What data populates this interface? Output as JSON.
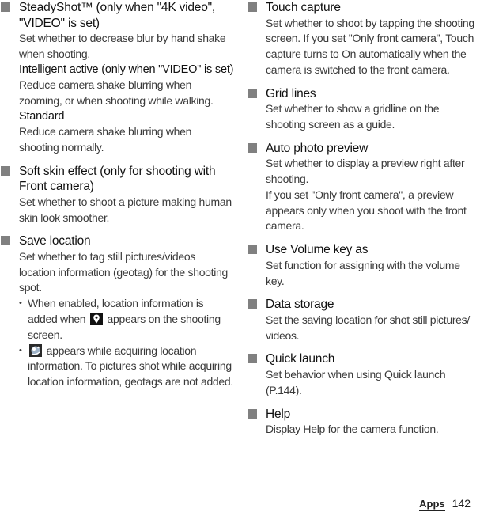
{
  "left_column": {
    "items": [
      {
        "title": "SteadyShot™ (only when \"4K video\", \"VIDEO\" is set)",
        "desc": "Set whether to decrease blur by hand shake when shooting.",
        "options": [
          {
            "label": "Intelligent active (only when \"VIDEO\" is set)",
            "desc": "Reduce camera shake blurring when zooming, or when shooting while walking."
          },
          {
            "label": "Standard",
            "desc": "Reduce camera shake blurring when shooting normally."
          }
        ]
      },
      {
        "title": "Soft skin effect (only for shooting with Front camera)",
        "desc": "Set whether to shoot a picture making human skin look smoother."
      },
      {
        "title": "Save location",
        "desc": "Set whether to tag still pictures/videos location information (geotag) for the shooting spot.",
        "bullets": [
          {
            "before": "When enabled, location information is added when",
            "icon": "location-pin-icon",
            "after": "appears on the shooting screen."
          },
          {
            "before": "",
            "icon": "acquiring-location-icon",
            "after": "appears while acquiring location information. To pictures shot while acquiring location information, geotags are not added."
          }
        ]
      }
    ]
  },
  "right_column": {
    "items": [
      {
        "title": "Touch capture",
        "desc": "Set whether to shoot by tapping the shooting screen. If you set \"Only front camera\", Touch capture turns to On automatically when the camera is switched to the front camera."
      },
      {
        "title": "Grid lines",
        "desc": "Set whether to show a gridline on the shooting screen as a guide."
      },
      {
        "title": "Auto photo preview",
        "desc": "Set whether to display a preview right after shooting.",
        "desc2": "If you set \"Only front camera\", a preview appears only when you shoot with the front camera."
      },
      {
        "title": "Use Volume key as",
        "desc": "Set function for assigning with the volume key."
      },
      {
        "title": "Data storage",
        "desc": "Set the saving location for shot still pictures/ videos."
      },
      {
        "title": "Quick launch",
        "desc": "Set behavior when using Quick launch (P.144)."
      },
      {
        "title": "Help",
        "desc": "Display Help for the camera function."
      }
    ]
  },
  "footer": {
    "section": "Apps",
    "page_number": "142"
  },
  "colors": {
    "marker": "#808080",
    "text": "#3a3a3a"
  }
}
